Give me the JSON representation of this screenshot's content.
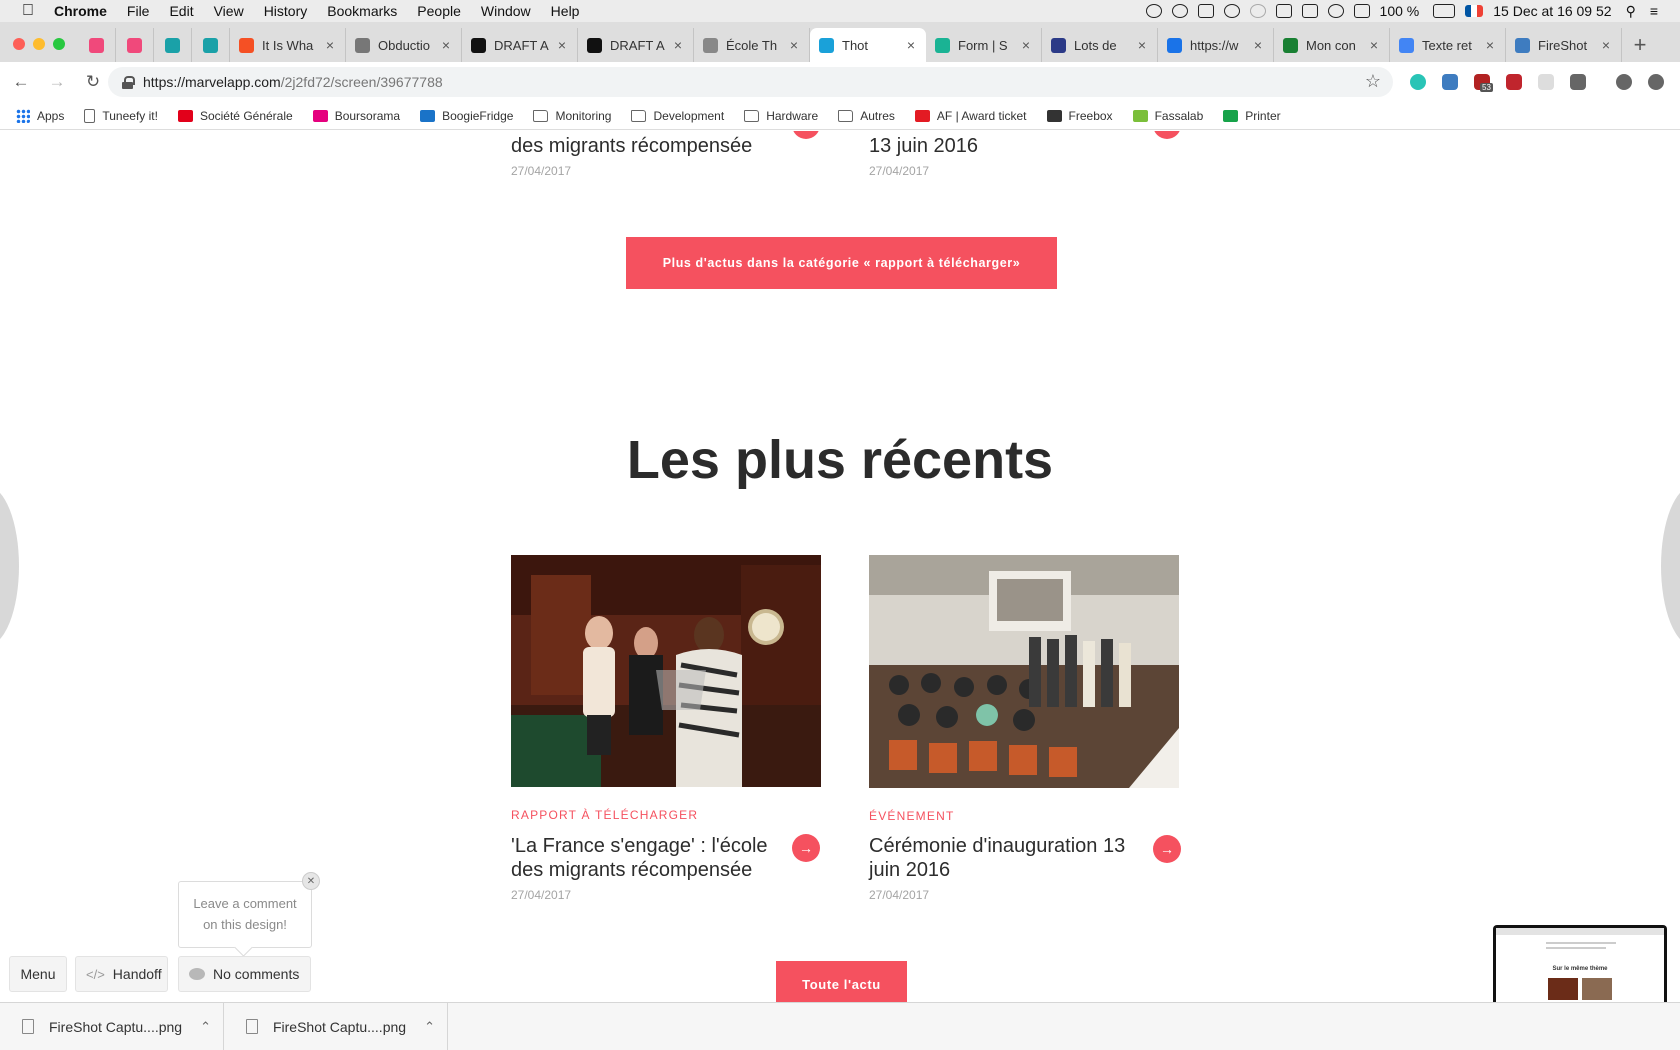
{
  "menubar": {
    "app": "Chrome",
    "items": [
      "File",
      "Edit",
      "View",
      "History",
      "Bookmarks",
      "People",
      "Window",
      "Help"
    ],
    "battery": "100 %",
    "datetime": "15 Dec at  16 09 52"
  },
  "tabs": [
    {
      "title": "",
      "icon_color": "#f0497b"
    },
    {
      "title": "",
      "icon_color": "#f0497b"
    },
    {
      "title": "",
      "icon_color": "#1aa1a8"
    },
    {
      "title": "",
      "icon_color": "#1aa1a8"
    },
    {
      "title": "It Is Wha",
      "icon_color": "#f55024"
    },
    {
      "title": "Obductio",
      "icon_color": "#777777"
    },
    {
      "title": "DRAFT A",
      "icon_color": "#111111"
    },
    {
      "title": "DRAFT A",
      "icon_color": "#111111"
    },
    {
      "title": "École Th",
      "icon_color": "#888888"
    },
    {
      "title": "Thot",
      "icon_color": "#1aa1d9",
      "active": true
    },
    {
      "title": "Form | S",
      "icon_color": "#1ab394"
    },
    {
      "title": "Lots de",
      "icon_color": "#2b3a87"
    },
    {
      "title": "https://w",
      "icon_color": "#1a73e8"
    },
    {
      "title": "Mon con",
      "icon_color": "#198033"
    },
    {
      "title": "Texte ret",
      "icon_color": "#4285f4"
    },
    {
      "title": "FireShot",
      "icon_color": "#3e7cc0"
    }
  ],
  "address": {
    "host": "https://marvelapp.com",
    "path": "/2j2fd72/screen/39677788"
  },
  "extensions_badge": "53",
  "bookmarks": [
    {
      "label": "Apps",
      "icon": "apps"
    },
    {
      "label": "Tuneefy it!",
      "icon": "doc"
    },
    {
      "label": "Société Générale",
      "icon": "sg",
      "color": "#e2001a"
    },
    {
      "label": "Boursorama",
      "icon": "bourso",
      "color": "#e5007e"
    },
    {
      "label": "BoogieFridge",
      "icon": "dsm",
      "color": "#1a73c8"
    },
    {
      "label": "Monitoring",
      "icon": "folder"
    },
    {
      "label": "Development",
      "icon": "folder"
    },
    {
      "label": "Hardware",
      "icon": "folder"
    },
    {
      "label": "Autres",
      "icon": "folder"
    },
    {
      "label": "AF | Award ticket",
      "icon": "af",
      "color": "#e31b23"
    },
    {
      "label": "Freebox",
      "icon": "free",
      "color": "#333333"
    },
    {
      "label": "Fassalab",
      "icon": "fassalab",
      "color": "#7bbf3a"
    },
    {
      "label": "Printer",
      "icon": "printer",
      "color": "#17a34a"
    }
  ],
  "top_cards": [
    {
      "title_fragment": "des migrants récompensée",
      "date": "27/04/2017"
    },
    {
      "title_fragment": "13 juin 2016",
      "date": "27/04/2017"
    }
  ],
  "category_button": "Plus d'actus dans la catégorie « rapport à télécharger»",
  "section_heading": "Les plus récents",
  "recent_cards": [
    {
      "category": "RAPPORT À TÉLÉCHARGER",
      "title": "'La France s'engage' : l'école des migrants récompensée",
      "date": "27/04/2017"
    },
    {
      "category": "ÉVÉNEMENT",
      "title": "Cérémonie d'inauguration 13 juin 2016",
      "date": "27/04/2017"
    }
  ],
  "all_news_button": "Toute l'actu",
  "marvel": {
    "comment_prompt": "Leave a comment on this design!",
    "menu": "Menu",
    "handoff": "Handoff",
    "comments": "No comments",
    "thumbnail_heading": "Sur le même thème"
  },
  "downloads": [
    "FireShot Captu....png",
    "FireShot Captu....png"
  ],
  "colors": {
    "accent": "#f5515f"
  }
}
